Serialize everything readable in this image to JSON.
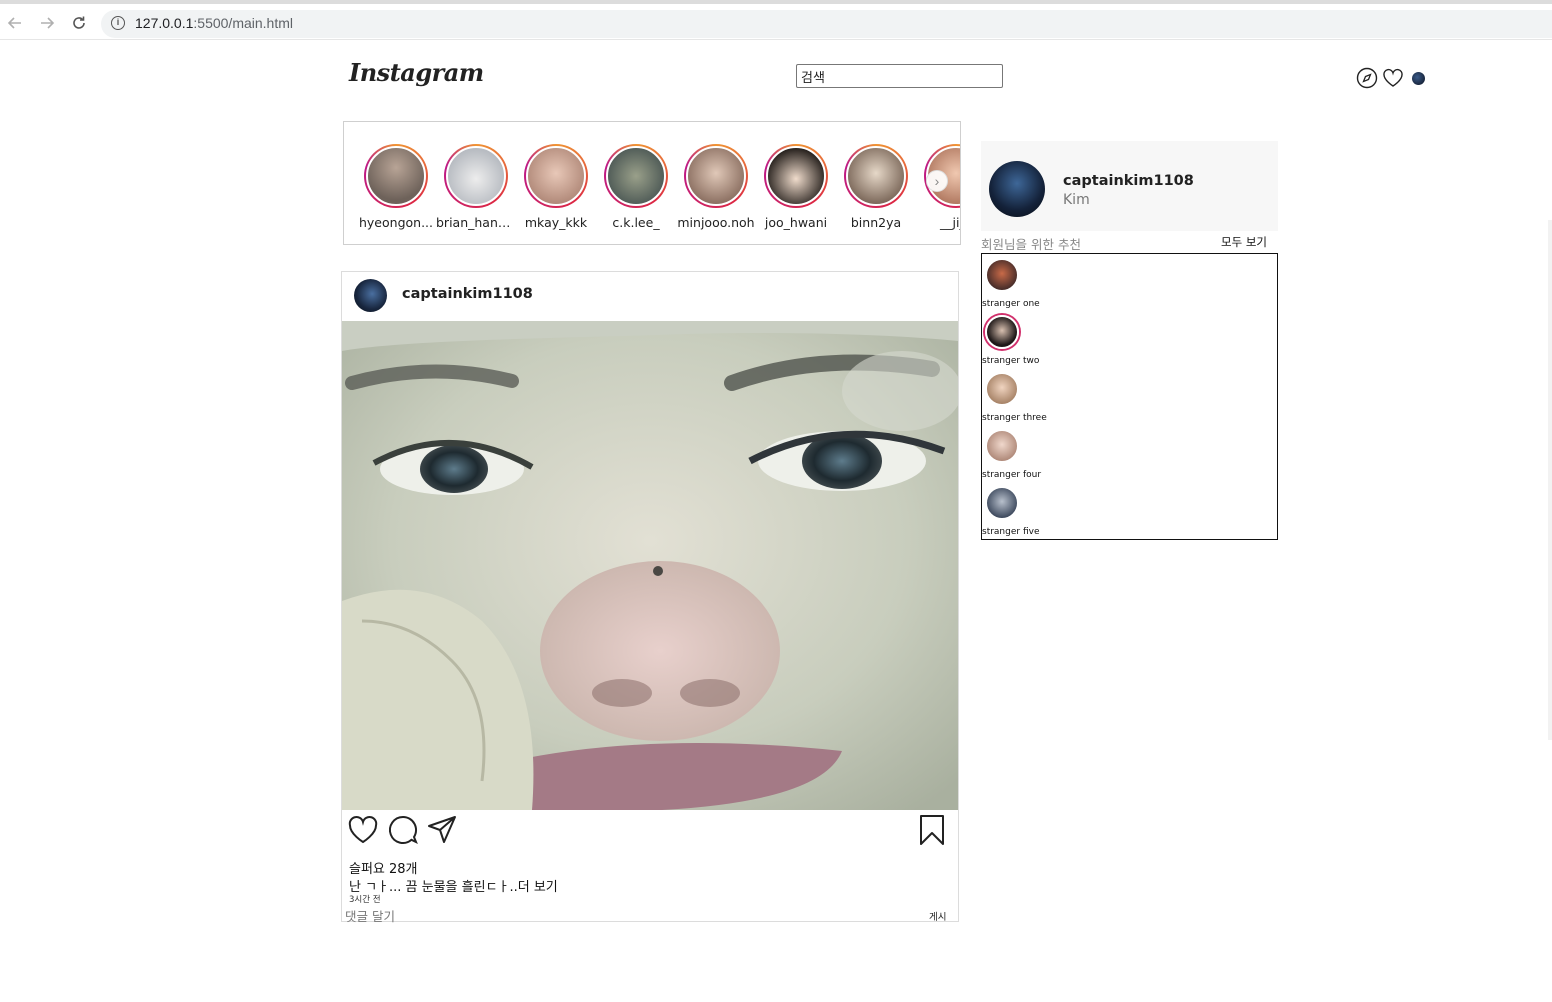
{
  "browser": {
    "url_host": "127.0.0.1",
    "url_rest": ":5500/main.html"
  },
  "header": {
    "logo_text": "Instagram",
    "search_value": "검색",
    "icons": [
      "compass-icon",
      "heart-icon",
      "profile-avatar"
    ]
  },
  "stories": [
    {
      "name": "hyeongon...",
      "color": "#8a7f78"
    },
    {
      "name": "brian_han_...",
      "color": "#c9cdd2"
    },
    {
      "name": "mkay_kkk",
      "color": "#d8b8a8"
    },
    {
      "name": "c.k.lee_",
      "color": "#7e8a78"
    },
    {
      "name": "minjooo.noh",
      "color": "#b89a8a"
    },
    {
      "name": "joo_hwani",
      "color": "#c7b7a7"
    },
    {
      "name": "binn2ya",
      "color": "#9c8a80"
    },
    {
      "name": "__ji__",
      "color": "#d4a08a"
    }
  ],
  "post": {
    "username": "captainkim1108",
    "likes": "슬퍼요 28개",
    "caption": "난 ㄱㅏ... 끔 눈물을 흘린ㄷㅏ..더 보기",
    "time": "3시간 전",
    "comment_placeholder": "댓글 달기",
    "post_button": "게시"
  },
  "profile": {
    "username": "captainkim1108",
    "name": "Kim"
  },
  "recommend": {
    "title": "회원님을 위한 추천",
    "see_all": "모두 보기",
    "items": [
      {
        "name": "stranger one",
        "color": "#8a4a3a"
      },
      {
        "name": "stranger two",
        "color": "#3a3030"
      },
      {
        "name": "stranger three",
        "color": "#c9a88e"
      },
      {
        "name": "stranger four",
        "color": "#d4b0a0"
      },
      {
        "name": "stranger five",
        "color": "#6a7a8e"
      }
    ]
  }
}
